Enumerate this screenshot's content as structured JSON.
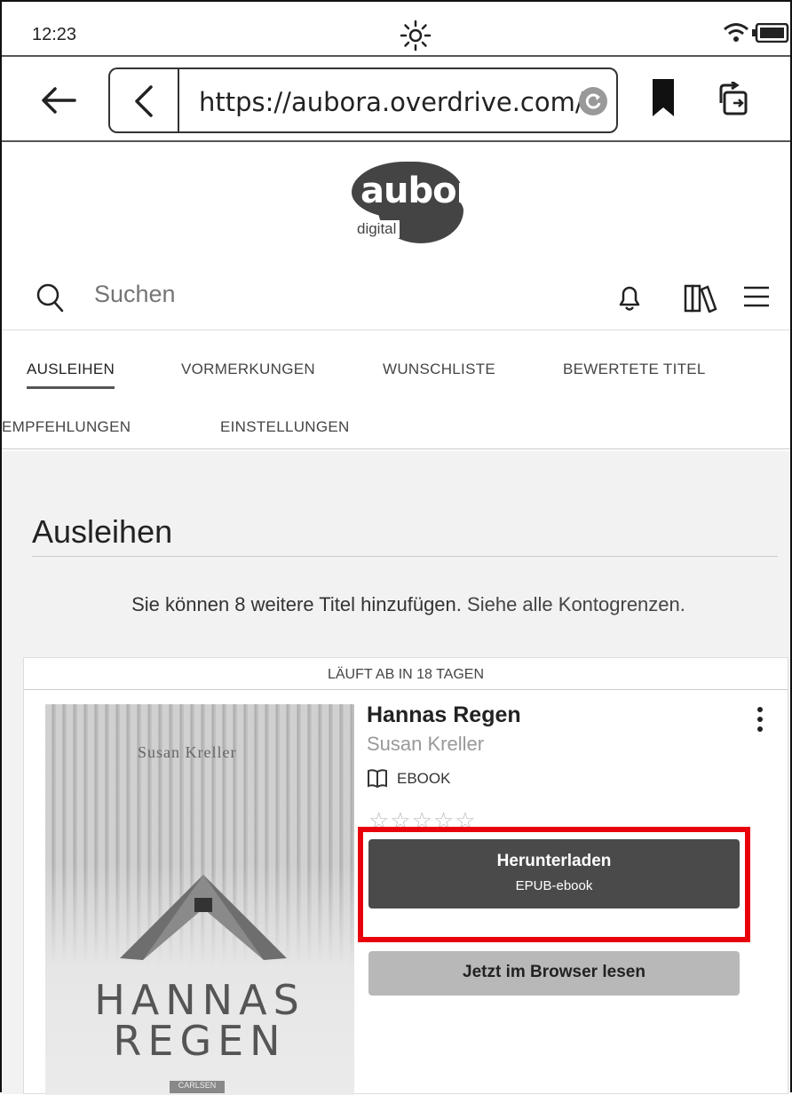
{
  "status": {
    "time": "12:23"
  },
  "browser": {
    "url": "https://aubora.overdrive.com/"
  },
  "logo": {
    "word": "aubora",
    "sub": "digital"
  },
  "search": {
    "placeholder": "Suchen"
  },
  "tabs": [
    {
      "label": "AUSLEIHEN",
      "active": true
    },
    {
      "label": "VORMERKUNGEN"
    },
    {
      "label": "WUNSCHLISTE"
    },
    {
      "label": "BEWERTETE TITEL"
    },
    {
      "label": "EMPFEHLUNGEN"
    },
    {
      "label": "EINSTELLUNGEN"
    }
  ],
  "page": {
    "title": "Ausleihen",
    "limits_text": "Sie können 8 weitere Titel hinzufügen.",
    "limits_link": "Siehe alle Kontogrenzen."
  },
  "loan": {
    "expires": "LÄUFT AB IN 18 TAGEN",
    "title": "Hannas Regen",
    "author": "Susan Kreller",
    "format": "EBOOK",
    "rating_stars": "☆☆☆☆☆",
    "cover": {
      "author": "Susan Kreller",
      "title_line1": "HANNAS",
      "title_line2": "REGEN",
      "publisher": "CARLSEN"
    },
    "download_label": "Herunterladen",
    "download_sub": "EPUB-ebook",
    "read_label": "Jetzt im Browser lesen"
  },
  "colors": {
    "highlight": "#e8000b",
    "primary_button": "#4a4a4a",
    "secondary_button": "#b8b8b8"
  },
  "icons": [
    "sun-icon",
    "wifi-icon",
    "battery-icon",
    "back-arrow-icon",
    "chevron-left-icon",
    "reload-icon",
    "bookmark-icon",
    "rotate-icon",
    "search-icon",
    "bell-icon",
    "books-icon",
    "menu-icon",
    "more-vertical-icon",
    "book-open-icon"
  ]
}
